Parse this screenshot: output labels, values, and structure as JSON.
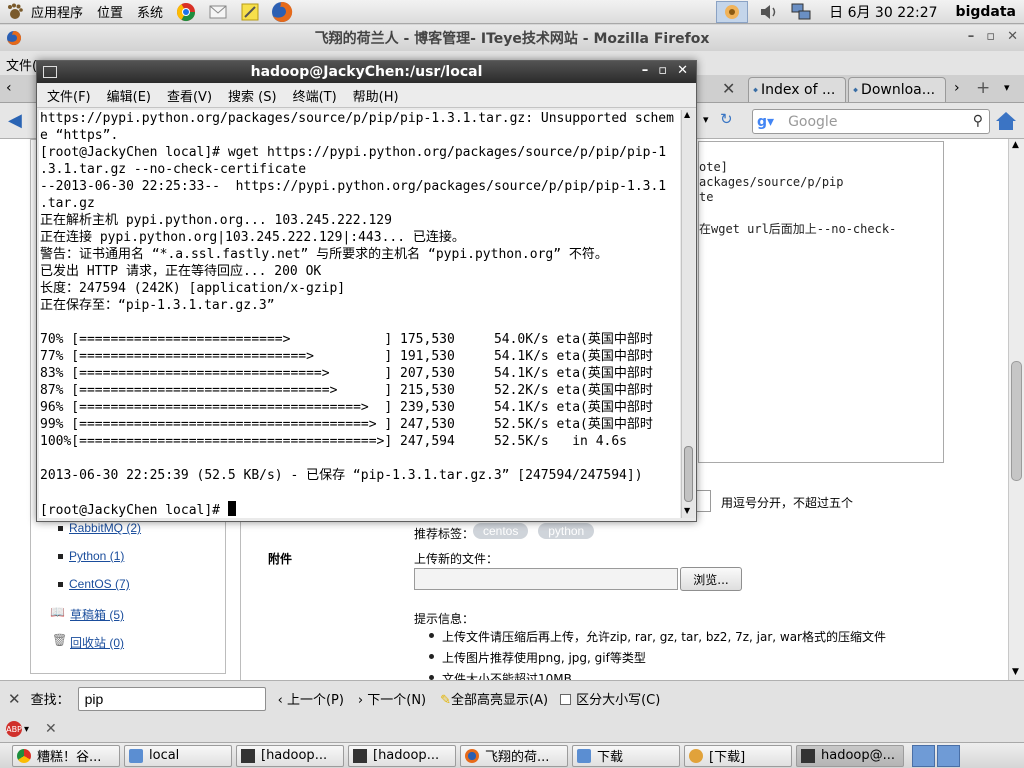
{
  "top_panel": {
    "menus": [
      "应用程序",
      "位置",
      "系统"
    ],
    "clock": "日 6月 30 22:27",
    "user": "bigdata"
  },
  "firefox": {
    "title": "飞翔的荷兰人 - 博客管理- ITeye技术网站 - Mozilla Firefox",
    "menubar_fragment": "文件(",
    "tabs": [
      "Index of ...",
      "Downloa..."
    ],
    "search_placeholder": "Google"
  },
  "terminal": {
    "title": "hadoop@JackyChen:/usr/local",
    "menu": [
      "文件(F)",
      "编辑(E)",
      "查看(V)",
      "搜索 (S)",
      "终端(T)",
      "帮助(H)"
    ],
    "lines": [
      "https://pypi.python.org/packages/source/p/pip/pip-1.3.1.tar.gz: Unsupported schem",
      "e “https”.",
      "[root@JackyChen local]# wget https://pypi.python.org/packages/source/p/pip/pip-1",
      ".3.1.tar.gz --no-check-certificate",
      "--2013-06-30 22:25:33--  https://pypi.python.org/packages/source/p/pip/pip-1.3.1",
      ".tar.gz",
      "正在解析主机 pypi.python.org... 103.245.222.129",
      "正在连接 pypi.python.org|103.245.222.129|:443... 已连接。",
      "警告：证书通用名 “*.a.ssl.fastly.net” 与所要求的主机名 “pypi.python.org” 不符。",
      "已发出 HTTP 请求，正在等待回应... 200 OK",
      "长度：247594 (242K) [application/x-gzip]",
      "正在保存至：“pip-1.3.1.tar.gz.3”",
      "",
      "70% [==========================>            ] 175,530     54.0K/s eta(英国中部时",
      "77% [=============================>         ] 191,530     54.1K/s eta(英国中部时",
      "83% [===============================>       ] 207,530     54.1K/s eta(英国中部时",
      "87% [================================>      ] 215,530     52.2K/s eta(英国中部时",
      "96% [====================================>  ] 239,530     54.1K/s eta(英国中部时",
      "99% [=====================================> ] 247,530     52.5K/s eta(英国中部时",
      "100%[======================================>] 247,594     52.5K/s   in 4.6s",
      "",
      "2013-06-30 22:25:39 (52.5 KB/s) - 已保存 “pip-1.3.1.tar.gz.3” [247594/247594])",
      "",
      "[root@JackyChen local]# "
    ]
  },
  "page": {
    "editor_lines": [
      "ote]",
      "ackages/source/p/pip",
      "te",
      "",
      "在wget url后面加上--no-check-"
    ],
    "tags_hint": "用逗号分开，不超过五个",
    "recommend_label": "推荐标签：",
    "tags": [
      "centos",
      "python"
    ],
    "attachment_label": "附件",
    "upload_label": "上传新的文件：",
    "browse_label": "浏览...",
    "hint_label": "提示信息：",
    "hints": [
      "上传文件请压缩后再上传，允许zip, rar, gz, tar, bz2, 7z, jar, war格式的压缩文件",
      "上传图片推荐使用png, jpg, gif等类型",
      "文件大小不能超过10MB"
    ],
    "sidebar": {
      "categories": [
        "RabbitMQ (2)",
        "Python (1)",
        "CentOS (7)"
      ],
      "drafts": "草稿箱 (5)",
      "trash": "回收站 (0)"
    }
  },
  "findbar": {
    "label": "查找：",
    "query": "pip",
    "prev": "上一个(P)",
    "next": "下一个(N)",
    "highlight": "全部高亮显示(A)",
    "match_case": "区分大小写(C)"
  },
  "taskbar": {
    "items": [
      "糟糕！谷...",
      "local",
      "[hadoop...",
      "[hadoop...",
      "飞翔的荷...",
      "下载",
      "[下载]",
      "hadoop@..."
    ]
  },
  "colors": {
    "terminal_title_bg": "#3a3a3a",
    "link_blue": "#1a4d9c",
    "tag_chip": "#cfd4da"
  }
}
